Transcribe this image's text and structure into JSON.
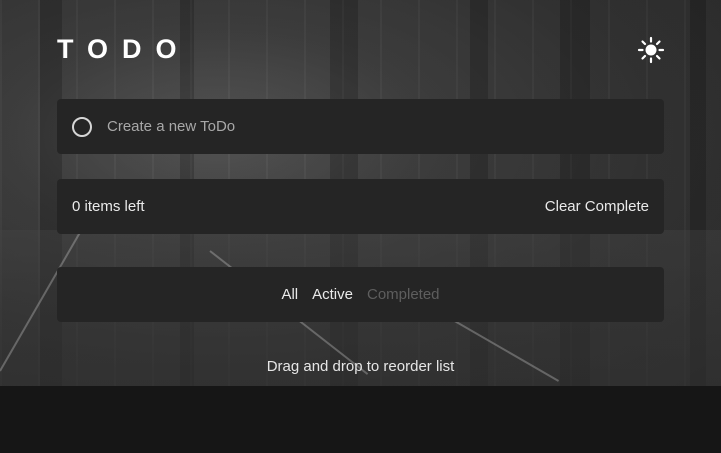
{
  "app": {
    "title": "TODO"
  },
  "header": {
    "theme_icon": "sun-icon"
  },
  "new_todo": {
    "placeholder": "Create a new ToDo"
  },
  "summary": {
    "items_left": "0 items left",
    "clear_label": "Clear Complete"
  },
  "filters": [
    {
      "label": "All",
      "state": "normal"
    },
    {
      "label": "Active",
      "state": "normal"
    },
    {
      "label": "Completed",
      "state": "dim"
    }
  ],
  "footer": {
    "hint": "Drag and drop to reorder list"
  },
  "colors": {
    "card": "#252525",
    "page": "#161616",
    "text": "#eaeaea",
    "muted": "#5e5e5e"
  }
}
